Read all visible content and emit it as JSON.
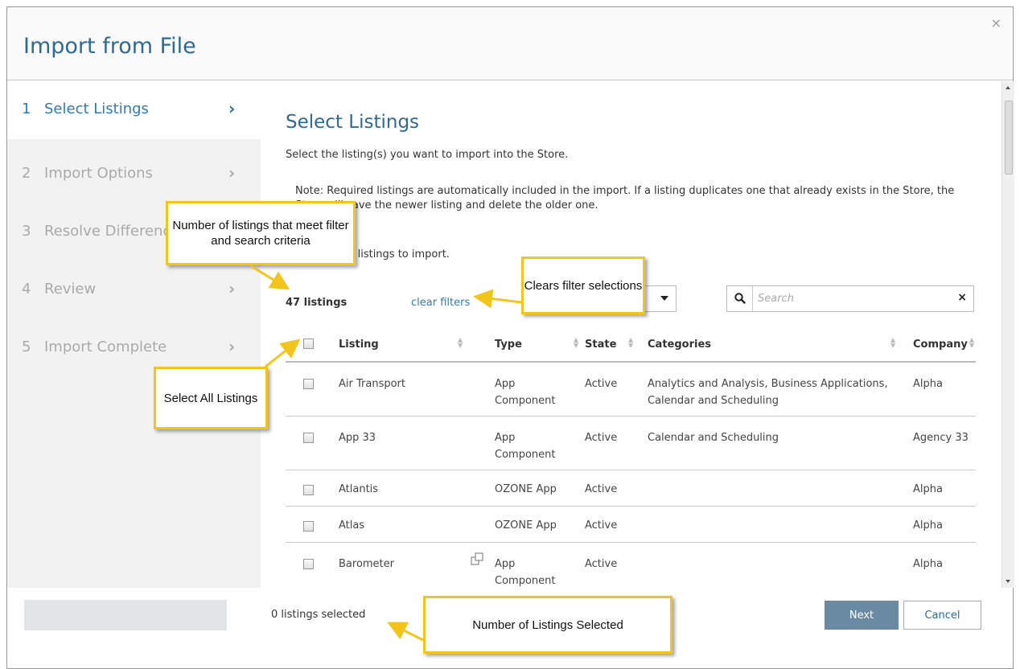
{
  "dialog": {
    "title": "Import from File",
    "close_label": "×"
  },
  "steps": [
    {
      "num": "1",
      "label": "Select Listings",
      "active": true
    },
    {
      "num": "2",
      "label": "Import Options",
      "active": false
    },
    {
      "num": "3",
      "label": "Resolve Differences",
      "active": false
    },
    {
      "num": "4",
      "label": "Review",
      "active": false
    },
    {
      "num": "5",
      "label": "Import Complete",
      "active": false
    }
  ],
  "main": {
    "title": "Select Listings",
    "intro": "Select the listing(s) you want to import into the Store.",
    "note": "Note: Required listings are automatically included in the import. If a listing duplicates one that already exists in the Store, the Store will save the newer listing and delete the older one.",
    "choose_text": "Choose the listings to import."
  },
  "toolbar": {
    "count": "47 listings",
    "clear_filters": "clear filters",
    "search_placeholder": "Search",
    "search_clear": "×"
  },
  "table": {
    "headers": {
      "listing": "Listing",
      "type": "Type",
      "state": "State",
      "categories": "Categories",
      "company": "Company"
    },
    "rows": [
      {
        "listing": "Air Transport",
        "type": "App Component",
        "state": "Active",
        "categories": "Analytics and Analysis, Business Applications, Calendar and Scheduling",
        "company": "Alpha"
      },
      {
        "listing": "App 33",
        "type": "App Component",
        "state": "Active",
        "categories": "Calendar and Scheduling",
        "company": "Agency 33"
      },
      {
        "listing": "Atlantis",
        "type": "OZONE App",
        "state": "Active",
        "categories": "",
        "company": "Alpha"
      },
      {
        "listing": "Atlas",
        "type": "OZONE App",
        "state": "Active",
        "categories": "",
        "company": "Alpha"
      },
      {
        "listing": "Barometer",
        "type": "App Component",
        "state": "Active",
        "categories": "",
        "company": "Alpha"
      }
    ]
  },
  "footer": {
    "selected_count": "0 listings selected",
    "next_label": "Next",
    "cancel_label": "Cancel"
  },
  "callouts": {
    "count_info": "Number of listings that meet filter and search criteria",
    "clear_info": "Clears filter selections",
    "select_all_info": "Select All Listings",
    "selected_info": "Number of Listings Selected"
  },
  "colors": {
    "accent": "#2e6a94",
    "link": "#2e7bb8",
    "callout_border": "#f3c41a",
    "next_button": "#6a8aa3"
  }
}
